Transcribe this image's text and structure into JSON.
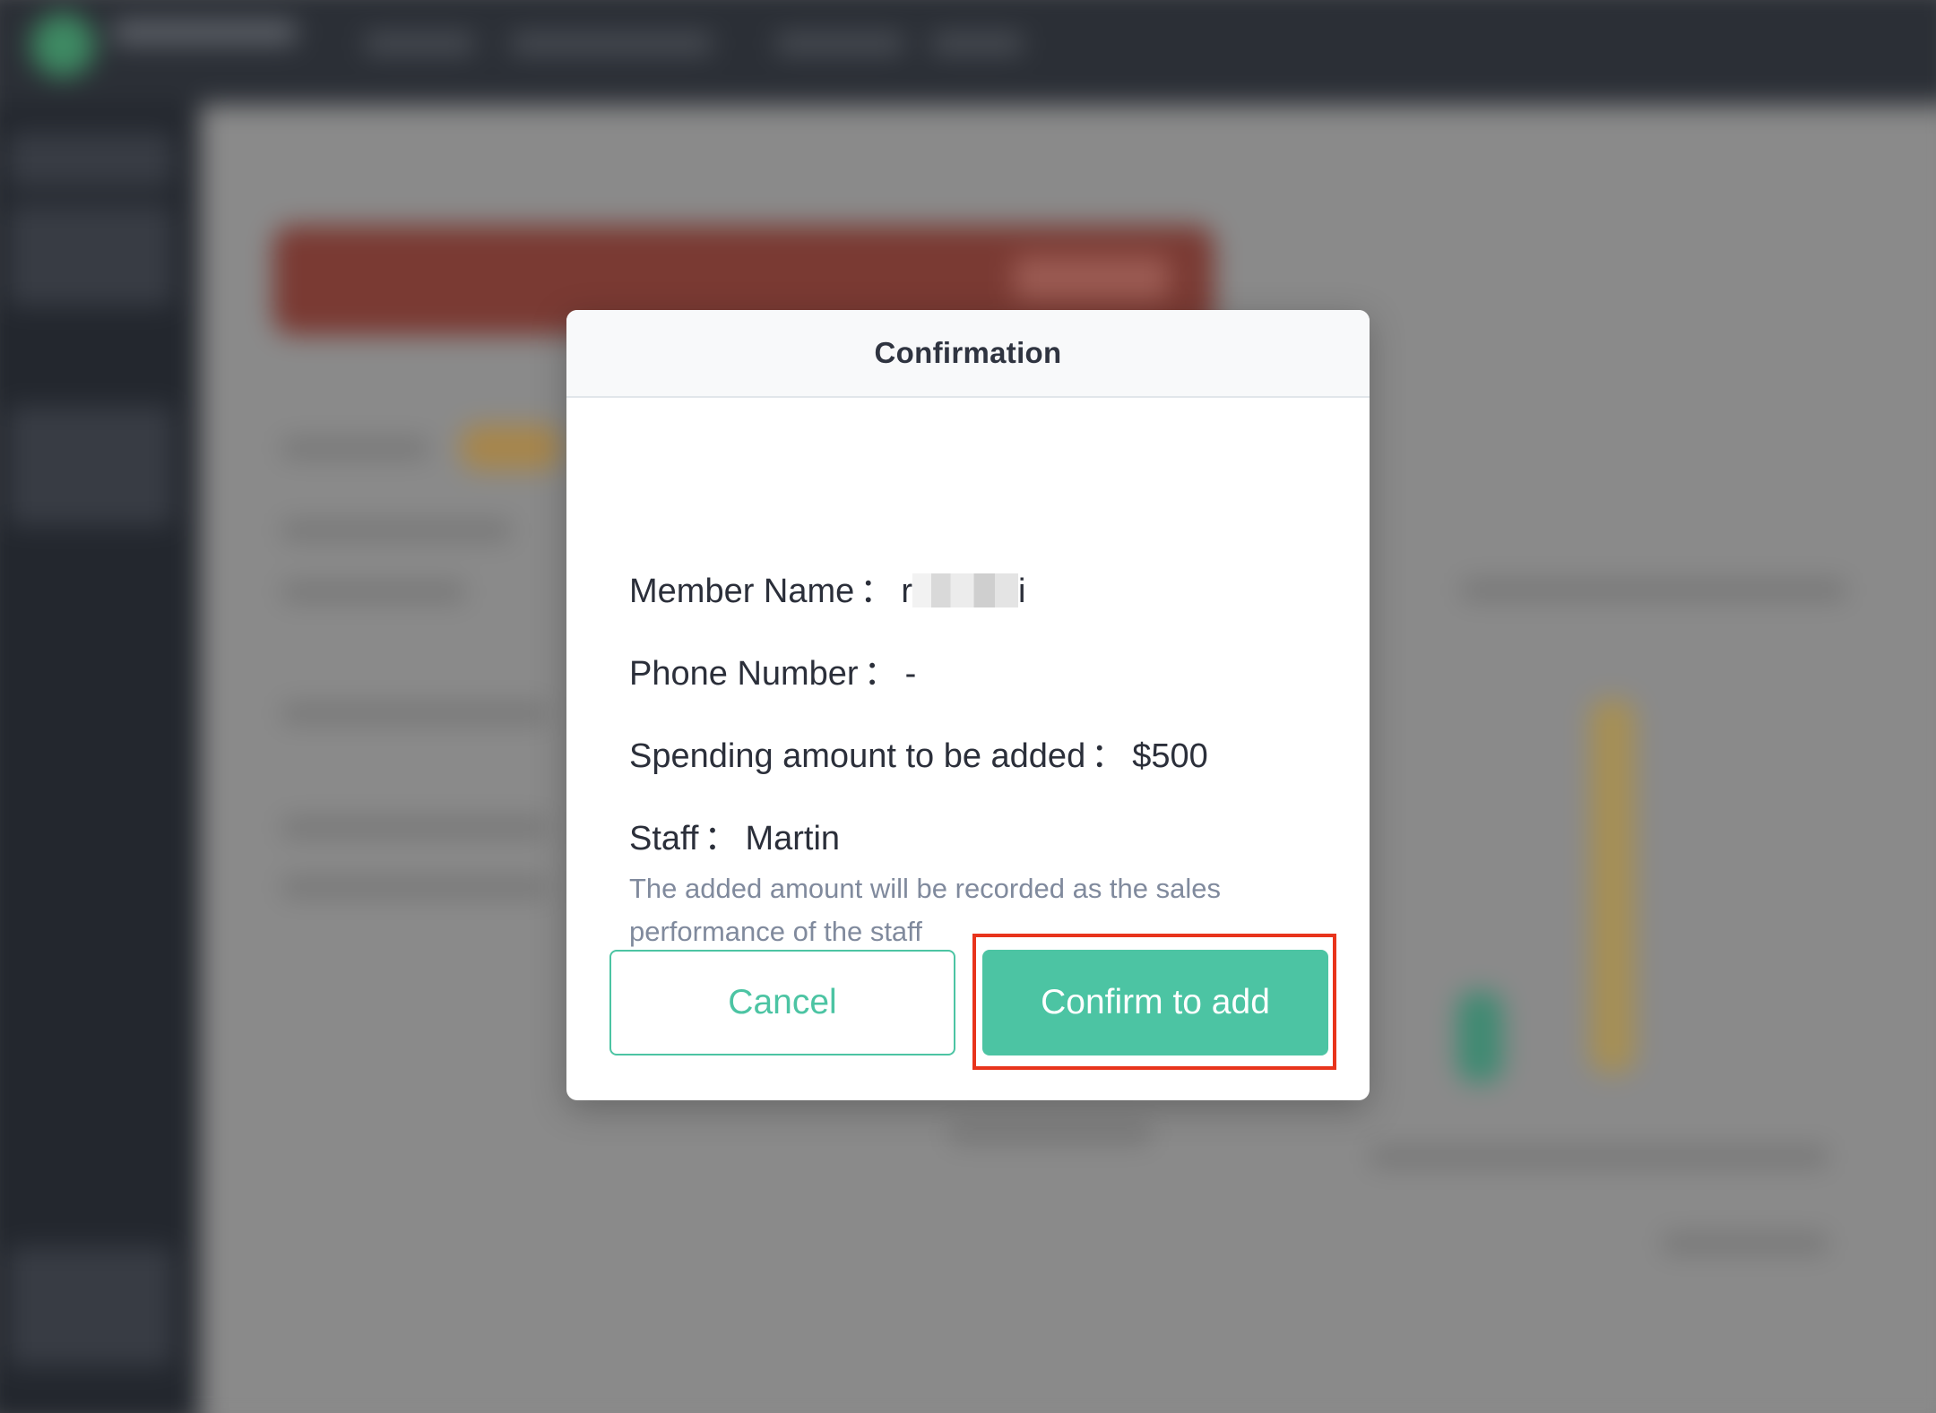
{
  "dialog": {
    "title": "Confirmation",
    "member_label": "Member Name",
    "member_value_start": "r",
    "member_value_end": "i",
    "phone_label": "Phone Number",
    "phone_value": "-",
    "amount_label": "Spending amount to be added",
    "amount_value": "$500",
    "staff_label": "Staff",
    "staff_value": "Martin",
    "separator": "：",
    "note": "The added amount will be recorded as the sales performance of the staff",
    "cancel_label": "Cancel",
    "confirm_label": "Confirm to add"
  },
  "colors": {
    "accent": "#4cc4a3",
    "highlight": "#e8341c"
  }
}
